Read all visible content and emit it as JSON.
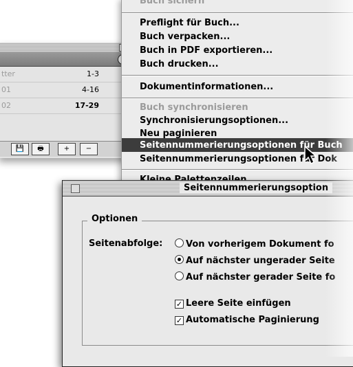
{
  "palette": {
    "menu_button": "▸",
    "rows": [
      {
        "doc": "tter",
        "pages": "1-3"
      },
      {
        "doc": "01",
        "pages": "4-16"
      },
      {
        "doc": "02",
        "pages": "17-29"
      }
    ],
    "buttons": [
      "💾",
      "🖶",
      "+",
      "−"
    ]
  },
  "menu": {
    "items": [
      {
        "label": "Buch sichern",
        "disabled": true
      },
      {
        "label": "Preflight für Buch..."
      },
      {
        "label": "Buch verpacken..."
      },
      {
        "label": "Buch in PDF exportieren..."
      },
      {
        "label": "Buch drucken..."
      },
      {
        "label": "Dokumentinformationen..."
      },
      {
        "label": "Buch synchronisieren",
        "disabled": true
      },
      {
        "label": "Synchronisierungsoptionen..."
      },
      {
        "label": "Neu paginieren"
      },
      {
        "label": "Seitennummerierungsoptionen für Buch",
        "selected": true
      },
      {
        "label": "Seitennummerierungsoptionen für Dok"
      },
      {
        "label": "Kleine Palettenzeilen"
      }
    ]
  },
  "dialog": {
    "title": "Seitennummerierungsoption",
    "group_label": "Optionen",
    "field_label": "Seitenabfolge:",
    "radios": [
      {
        "label": "Von vorherigem Dokument fo",
        "checked": false
      },
      {
        "label": "Auf nächster ungerader Seite",
        "checked": true
      },
      {
        "label": "Auf nächster gerader Seite fo",
        "checked": false
      }
    ],
    "checkboxes": [
      {
        "label": "Leere Seite einfügen",
        "checked": true
      },
      {
        "label": "Automatische Paginierung",
        "checked": true
      }
    ]
  }
}
